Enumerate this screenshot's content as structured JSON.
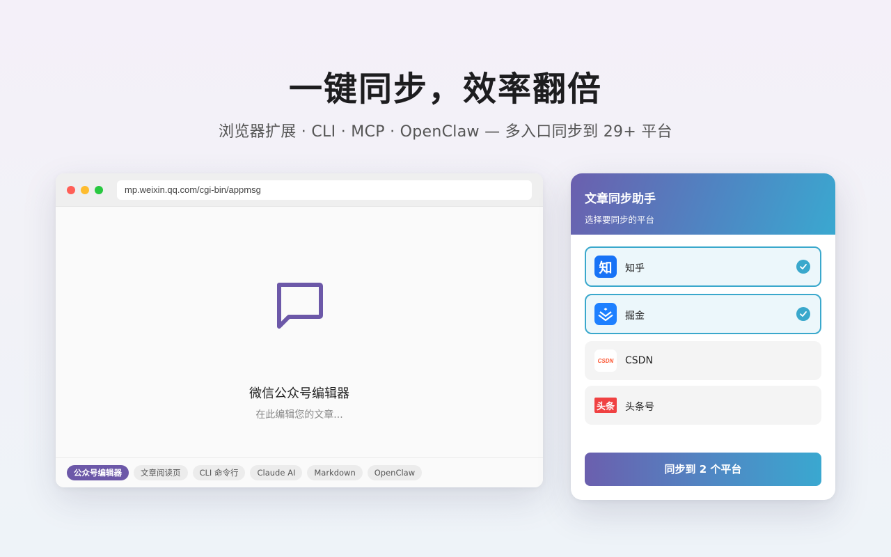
{
  "hero": {
    "title": "一键同步，效率翻倍",
    "subtitle": "浏览器扩展 · CLI · MCP · OpenClaw — 多入口同步到 29+ 平台"
  },
  "browser": {
    "url": "mp.weixin.qq.com/cgi-bin/appmsg",
    "editor_icon": "chat-bubble-icon",
    "editor_title": "微信公众号编辑器",
    "editor_placeholder": "在此编辑您的文章...",
    "tabs": [
      {
        "label": "公众号编辑器",
        "active": true
      },
      {
        "label": "文章阅读页",
        "active": false
      },
      {
        "label": "CLI 命令行",
        "active": false
      },
      {
        "label": "Claude AI",
        "active": false
      },
      {
        "label": "Markdown",
        "active": false
      },
      {
        "label": "OpenClaw",
        "active": false
      }
    ]
  },
  "panel": {
    "title": "文章同步助手",
    "subtitle": "选择要同步的平台",
    "platforms": [
      {
        "name": "知乎",
        "icon": "zhihu-logo-icon",
        "icon_text": "知",
        "selected": true,
        "color": "#1772f6"
      },
      {
        "name": "掘金",
        "icon": "juejin-logo-icon",
        "selected": true,
        "color": "#1e80ff"
      },
      {
        "name": "CSDN",
        "icon": "csdn-logo-icon",
        "icon_text": "CSDN",
        "selected": false,
        "color": "#fc5531"
      },
      {
        "name": "头条号",
        "icon": "toutiao-logo-icon",
        "icon_text": "头条",
        "selected": false,
        "color": "#f04142"
      }
    ],
    "sync_button": "同步到 2 个平台"
  },
  "colors": {
    "accent_purple": "#6c58a8",
    "accent_teal": "#3aa8cc"
  }
}
